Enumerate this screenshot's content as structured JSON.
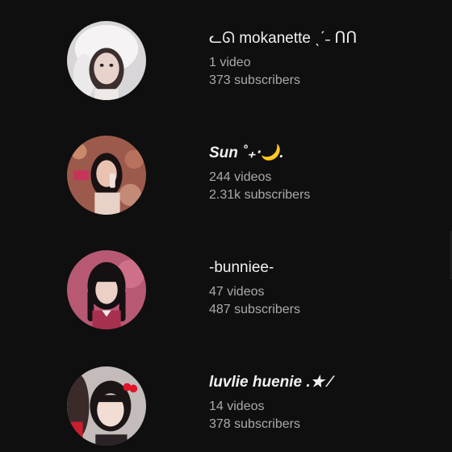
{
  "channels": [
    {
      "name": "ᓚᘏ  mokanette ˎˊ˗  ᑎᑎ",
      "videos": "1 video",
      "subscribers": "373 subscribers",
      "avatar_icon": "avatar-white-bonnet",
      "colors": {
        "bg": "#d8d6d9",
        "accent": "#f5f3f4",
        "skin": "#e7d3cc",
        "hair": "#3a2e2e"
      }
    },
    {
      "name": "Sun ˚₊‧🌙.",
      "videos": "244 videos",
      "subscribers": "2.31k subscribers",
      "avatar_icon": "avatar-girl-drink",
      "colors": {
        "bg": "#9c5a4c",
        "accent": "#c7345a",
        "skin": "#e9c3b2",
        "hair": "#1a1212"
      }
    },
    {
      "name": "-bunniee-",
      "videos": "47 videos",
      "subscribers": "487 subscribers",
      "avatar_icon": "avatar-girl-pink",
      "colors": {
        "bg": "#b85973",
        "accent": "#d77a93",
        "skin": "#ecd0c6",
        "hair": "#151012"
      }
    },
    {
      "name": "luvlie huenie .★ ⁄",
      "videos": "14 videos",
      "subscribers": "378 subscribers",
      "avatar_icon": "avatar-girl-red-bow",
      "colors": {
        "bg": "#c3bcbb",
        "accent": "#e0152b",
        "skin": "#f1ddd4",
        "hair": "#1c1515"
      }
    }
  ]
}
